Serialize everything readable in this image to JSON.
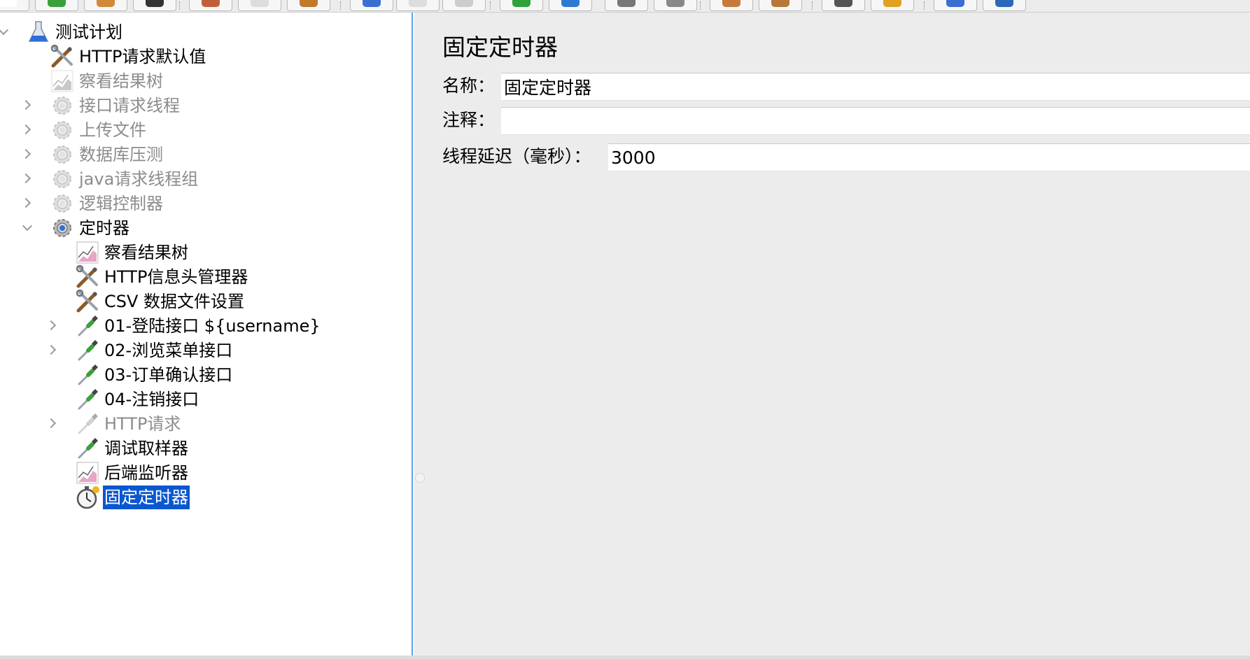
{
  "toolbar": {
    "buttons": [
      {
        "icon": "new-icon",
        "color": "#ffffff"
      },
      {
        "icon": "templates-icon",
        "color": "#3aa03a"
      },
      {
        "icon": "open-icon",
        "color": "#d08a3a"
      },
      {
        "icon": "save-icon",
        "color": "#333333"
      },
      {
        "icon": "cut-icon",
        "color": "#c0603a"
      },
      {
        "icon": "copy-icon",
        "color": "#dddddd"
      },
      {
        "icon": "paste-icon",
        "color": "#c07a2a"
      },
      {
        "icon": "expand-icon",
        "color": "#3a6fd0"
      },
      {
        "icon": "collapse-icon",
        "color": "#dddddd"
      },
      {
        "icon": "toggle-icon",
        "color": "#cccccc"
      },
      {
        "icon": "start-icon",
        "color": "#2fa33a"
      },
      {
        "icon": "start-no-pause-icon",
        "color": "#2f7ad0"
      },
      {
        "icon": "stop-icon",
        "color": "#777777"
      },
      {
        "icon": "shutdown-icon",
        "color": "#888888"
      },
      {
        "icon": "clear-icon",
        "color": "#c67a3a"
      },
      {
        "icon": "clear-all-icon",
        "color": "#b9763a"
      },
      {
        "icon": "search-icon",
        "color": "#555555"
      },
      {
        "icon": "reset-search-icon",
        "color": "#e0a020"
      },
      {
        "icon": "function-helper-icon",
        "color": "#3a6fd0"
      },
      {
        "icon": "help-icon",
        "color": "#2a6ab8"
      }
    ]
  },
  "tree": {
    "items": [
      {
        "label": "测试计划",
        "icon": "test-plan-flask-icon",
        "chevron": "open",
        "state": "normal"
      },
      {
        "label": "HTTP请求默认值",
        "icon": "config-tools-icon",
        "chevron": "",
        "state": "normal"
      },
      {
        "label": "察看结果树",
        "icon": "listener-chart-icon",
        "chevron": "",
        "state": "disabled"
      },
      {
        "label": "接口请求线程",
        "icon": "thread-group-gear-icon",
        "chevron": "closed",
        "state": "disabled"
      },
      {
        "label": "上传文件",
        "icon": "thread-group-gear-icon",
        "chevron": "closed",
        "state": "disabled"
      },
      {
        "label": "数据库压测",
        "icon": "thread-group-gear-icon",
        "chevron": "closed",
        "state": "disabled"
      },
      {
        "label": "java请求线程组",
        "icon": "thread-group-gear-icon",
        "chevron": "closed",
        "state": "disabled"
      },
      {
        "label": "逻辑控制器",
        "icon": "thread-group-gear-icon",
        "chevron": "closed",
        "state": "disabled"
      },
      {
        "label": "定时器",
        "icon": "thread-group-gear-icon",
        "chevron": "open",
        "state": "normal"
      },
      {
        "label": "察看结果树",
        "icon": "listener-chart-icon",
        "chevron": "",
        "state": "normal"
      },
      {
        "label": "HTTP信息头管理器",
        "icon": "config-tools-icon",
        "chevron": "",
        "state": "normal"
      },
      {
        "label": "CSV 数据文件设置",
        "icon": "config-tools-icon",
        "chevron": "",
        "state": "normal"
      },
      {
        "label": "01-登陆接口 ${username}",
        "icon": "sampler-pipette-icon",
        "chevron": "closed",
        "state": "normal"
      },
      {
        "label": "02-浏览菜单接口",
        "icon": "sampler-pipette-icon",
        "chevron": "closed",
        "state": "normal"
      },
      {
        "label": "03-订单确认接口",
        "icon": "sampler-pipette-icon",
        "chevron": "",
        "state": "normal"
      },
      {
        "label": "04-注销接口",
        "icon": "sampler-pipette-icon",
        "chevron": "",
        "state": "normal"
      },
      {
        "label": "HTTP请求",
        "icon": "sampler-pipette-icon",
        "chevron": "closed",
        "state": "disabled"
      },
      {
        "label": "调试取样器",
        "icon": "sampler-pipette-icon",
        "chevron": "",
        "state": "normal"
      },
      {
        "label": "后端监听器",
        "icon": "listener-chart-icon",
        "chevron": "",
        "state": "normal"
      },
      {
        "label": "固定定时器",
        "icon": "timer-stopwatch-icon",
        "chevron": "",
        "state": "selected"
      }
    ]
  },
  "config": {
    "title": "固定定时器",
    "name_label": "名称：",
    "name_value": "固定定时器",
    "comment_label": "注释：",
    "comment_value": "",
    "delay_label": "线程延迟（毫秒）：",
    "delay_value": "3000"
  },
  "colors": {
    "selection": "#0b57d0",
    "panel_bg": "#ececec",
    "splitter_focus": "#5aa5e6",
    "disabled_text": "#8c8c8c"
  }
}
